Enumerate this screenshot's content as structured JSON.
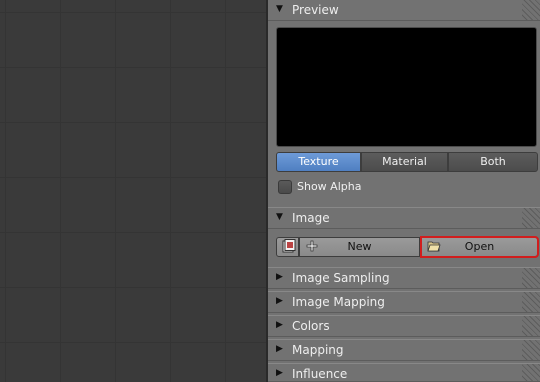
{
  "panels": {
    "preview": {
      "label": "Preview"
    },
    "image": {
      "label": "Image"
    },
    "collapsed": [
      {
        "label": "Image Sampling"
      },
      {
        "label": "Image Mapping"
      },
      {
        "label": "Colors"
      },
      {
        "label": "Mapping"
      },
      {
        "label": "Influence"
      }
    ]
  },
  "preview_tabs": [
    {
      "label": "Texture",
      "active": true
    },
    {
      "label": "Material",
      "active": false
    },
    {
      "label": "Both",
      "active": false
    }
  ],
  "show_alpha": {
    "label": "Show Alpha",
    "checked": false
  },
  "image_buttons": {
    "new_label": "New",
    "open_label": "Open"
  },
  "icons": {
    "expanded": "triangle-down-icon",
    "collapsed": "triangle-right-icon",
    "browse": "image-browse-icon",
    "new": "plus-icon",
    "open": "folder-open-icon"
  },
  "colors": {
    "accent": "#5a86c8",
    "highlight": "#d11d1d",
    "panel": "#727272",
    "viewport": "#3a3a3a"
  }
}
